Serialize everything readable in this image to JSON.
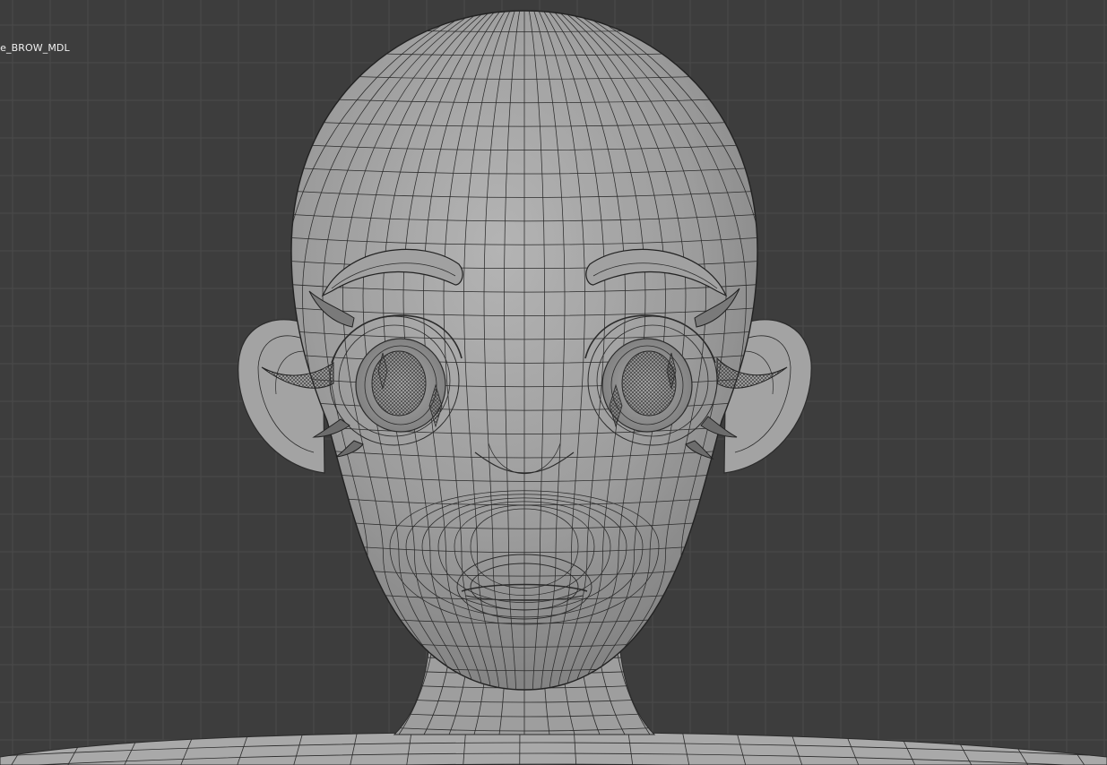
{
  "viewport": {
    "active_object_label": "ce_BROW_MDL",
    "background_color": "#3d3d3d",
    "grid_color": "#4a4a4a",
    "mesh_fill_color": "#9a9a9a",
    "wire_color": "#2b2b2b"
  }
}
